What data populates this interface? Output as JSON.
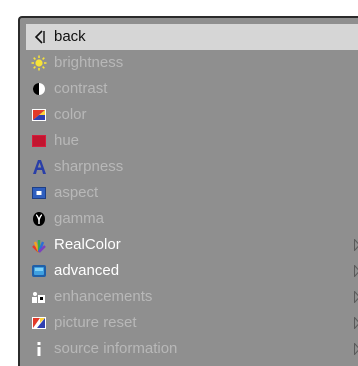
{
  "menu": {
    "items": [
      {
        "label": "back",
        "icon": "back-triangle-icon",
        "state": "selected"
      },
      {
        "label": "brightness",
        "icon": "sun-icon",
        "state": "disabled"
      },
      {
        "label": "contrast",
        "icon": "contrast-half-circle-icon",
        "state": "disabled"
      },
      {
        "label": "color",
        "icon": "color-square-icon",
        "state": "disabled"
      },
      {
        "label": "hue",
        "icon": "red-square-icon",
        "state": "disabled"
      },
      {
        "label": "sharpness",
        "icon": "letter-a-icon",
        "state": "disabled"
      },
      {
        "label": "aspect",
        "icon": "aspect-square-icon",
        "state": "disabled"
      },
      {
        "label": "gamma",
        "icon": "gamma-icon",
        "state": "disabled"
      },
      {
        "label": "RealColor",
        "icon": "realcolor-fan-icon",
        "state": "enabled",
        "submenu": true
      },
      {
        "label": "advanced",
        "icon": "advanced-monitor-icon",
        "state": "enabled",
        "submenu": true
      },
      {
        "label": "enhancements",
        "icon": "enhancements-icon",
        "state": "disabled",
        "submenu": true
      },
      {
        "label": "picture reset",
        "icon": "picture-reset-icon",
        "state": "disabled",
        "submenu": true
      },
      {
        "label": "source information",
        "icon": "info-i-icon",
        "state": "disabled",
        "submenu": true
      }
    ]
  },
  "colors": {
    "panel": "#8f8f8f",
    "selected_row": "#d6d6d6",
    "enabled_text": "#ffffff",
    "disabled_text": "#b8b8b8"
  }
}
